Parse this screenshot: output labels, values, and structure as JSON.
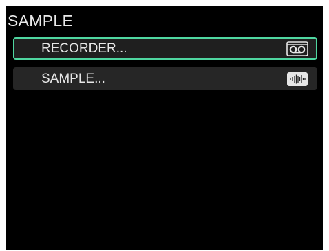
{
  "screen": {
    "title": "SAMPLE"
  },
  "menu": {
    "items": [
      {
        "label": "RECORDER...",
        "icon": "cassette-icon",
        "selected": true
      },
      {
        "label": "SAMPLE...",
        "icon": "waveform-icon",
        "selected": false
      }
    ]
  },
  "colors": {
    "background": "#000000",
    "item_background": "#262626",
    "selection_border": "#4fd6a0",
    "text": "#e6e6e6"
  }
}
